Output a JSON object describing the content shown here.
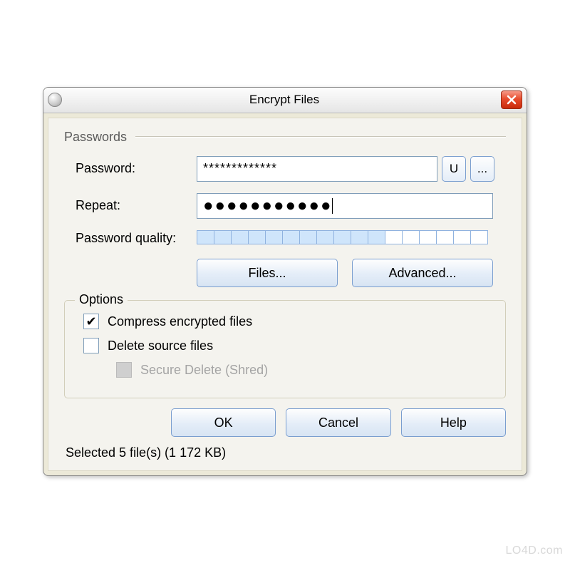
{
  "titlebar": {
    "title": "Encrypt Files"
  },
  "passwords_section": {
    "title": "Passwords",
    "password_label": "Password:",
    "password_value": "*************",
    "u_button": "U",
    "browse_button": "...",
    "repeat_label": "Repeat:",
    "repeat_value": "●●●●●●●●●●●",
    "quality_label": "Password quality:",
    "quality_total": 17,
    "quality_filled": 11,
    "files_button": "Files...",
    "advanced_button": "Advanced..."
  },
  "options": {
    "title": "Options",
    "compress_label": "Compress encrypted files",
    "compress_checked": true,
    "delete_label": "Delete source files",
    "delete_checked": false,
    "shred_label": "Secure Delete (Shred)",
    "shred_checked": false,
    "shred_enabled": false
  },
  "actions": {
    "ok": "OK",
    "cancel": "Cancel",
    "help": "Help"
  },
  "status": "Selected 5 file(s) (1 172 KB)",
  "watermark": "LO4D.com"
}
